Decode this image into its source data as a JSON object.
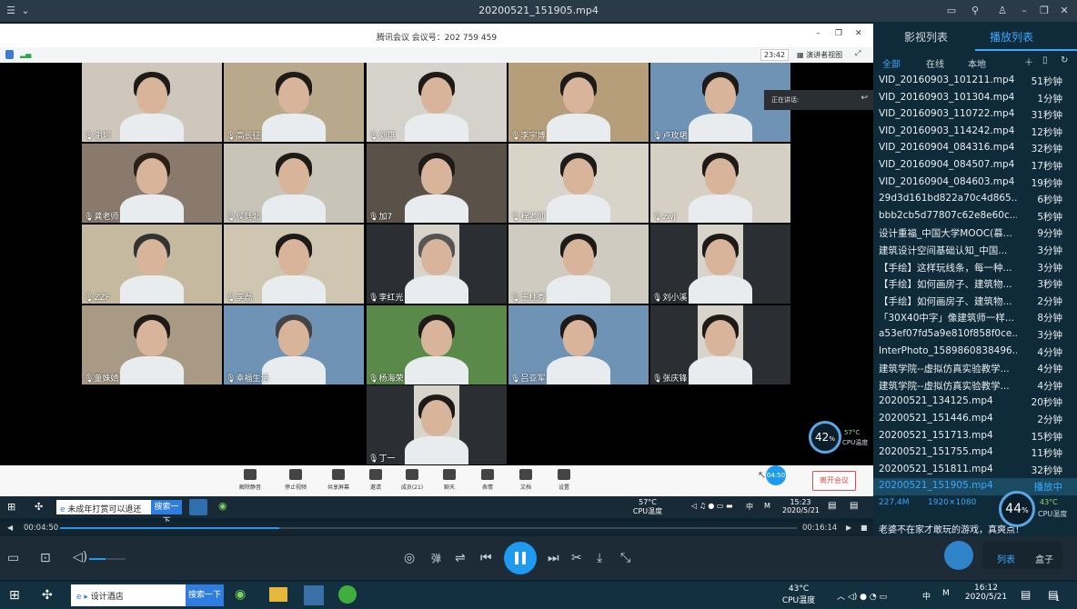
{
  "player": {
    "title": "20200521_151905.mp4"
  },
  "meeting": {
    "title": "腾讯会议 会议号：202 759 459",
    "clock": "23:42",
    "view_label": "演讲者视图",
    "speaking_label": "正在讲话:",
    "participants": [
      "谢珂",
      "高长征",
      "刘琪",
      "李宇博",
      "卢玫珺",
      "龚老师",
      "侯廷北",
      "加7",
      "程老师",
      "zwj",
      "ZZF",
      "李磊",
      "李红光",
      "王桂秀",
      "刘小溪",
      "董姝婧",
      "幸福生活",
      "杨海荣",
      "吕亚军",
      "张庆锋",
      "丁一"
    ],
    "toolbar": [
      "解除静音",
      "停止视频",
      "共享屏幕",
      "邀请",
      "成员(21)",
      "聊天",
      "表情",
      "文档",
      "设置"
    ],
    "leave": "离开会议",
    "timer": "04:50",
    "gauge_pct": "42",
    "gauge_unit": "%",
    "cpu_temp": "57°C",
    "cpu_label": "CPU温度"
  },
  "inner_taskbar": {
    "search_text": "未成年打赏可以退还",
    "search_btn": "搜索一下",
    "temp": "57°C",
    "temp_label": "CPU温度",
    "input_method": "中",
    "time": "15:23",
    "date": "2020/5/21"
  },
  "playlist": {
    "tabs": [
      "影视列表",
      "播放列表"
    ],
    "filters": [
      "全部",
      "在线",
      "本地"
    ],
    "items": [
      {
        "name": "VID_20160903_101211.mp4",
        "dur": "51秒钟"
      },
      {
        "name": "VID_20160903_101304.mp4",
        "dur": "1分钟"
      },
      {
        "name": "VID_20160903_110722.mp4",
        "dur": "31秒钟"
      },
      {
        "name": "VID_20160903_114242.mp4",
        "dur": "12秒钟"
      },
      {
        "name": "VID_20160904_084316.mp4",
        "dur": "32秒钟"
      },
      {
        "name": "VID_20160904_084507.mp4",
        "dur": "17秒钟"
      },
      {
        "name": "VID_20160904_084603.mp4",
        "dur": "19秒钟"
      },
      {
        "name": "29d3d161bd822a70c4d865...",
        "dur": "6秒钟"
      },
      {
        "name": "bbb2cb5d77807c62e8e60c...",
        "dur": "5秒钟"
      },
      {
        "name": "设计重福_中国大学MOOC(慕...",
        "dur": "9分钟"
      },
      {
        "name": "建筑设计空间基础认知_中国...",
        "dur": "3分钟"
      },
      {
        "name": "【手绘】这样玩线条，每一种...",
        "dur": "3分钟"
      },
      {
        "name": "【手绘】如何画房子、建筑物...",
        "dur": "3秒钟"
      },
      {
        "name": "【手绘】如何画房子、建筑物...",
        "dur": "2分钟"
      },
      {
        "name": "「30X40中字」像建筑师一样...",
        "dur": "8分钟"
      },
      {
        "name": "a53ef07fd5a9e810f858f0ce...",
        "dur": "3分钟"
      },
      {
        "name": "InterPhoto_1589860838496...",
        "dur": "4分钟"
      },
      {
        "name": "建筑学院--虚拟仿真实验教学...",
        "dur": "4分钟"
      },
      {
        "name": "建筑学院--虚拟仿真实验教学...",
        "dur": "4分钟"
      },
      {
        "name": "20200521_134125.mp4",
        "dur": "20秒钟"
      },
      {
        "name": "20200521_151446.mp4",
        "dur": "2分钟"
      },
      {
        "name": "20200521_151713.mp4",
        "dur": "15秒钟"
      },
      {
        "name": "20200521_151755.mp4",
        "dur": "11秒钟"
      },
      {
        "name": "20200521_151811.mp4",
        "dur": "32秒钟"
      },
      {
        "name": "20200521_151905.mp4",
        "dur": "播放中"
      }
    ],
    "file_size": "227.4M",
    "resolution": "1920×1080",
    "gauge_pct": "44",
    "gauge_unit": "%",
    "cpu_temp": "43°C",
    "cpu_label": "CPU温度",
    "marquee": "老婆不在家才敢玩的游戏，真爽点！",
    "btn_list": "列表",
    "btn_box": "盒子"
  },
  "seek": {
    "elapsed": "00:04:50",
    "total": "00:16:14",
    "progress": 0.298
  },
  "taskbar": {
    "search_text": "设计酒店",
    "search_btn": "搜索一下",
    "temp": "43°C",
    "temp_label": "CPU温度",
    "input_method": "中",
    "time": "16:12",
    "date": "2020/5/21",
    "notif": "1"
  },
  "colors": {
    "accent": "#1e9bf0",
    "leave": "#e04b4b"
  }
}
